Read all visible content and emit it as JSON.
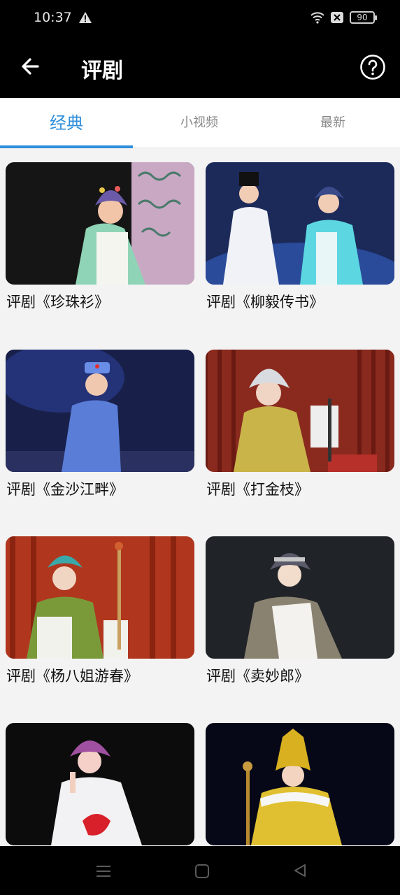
{
  "status": {
    "time": "10:37",
    "battery": "90"
  },
  "header": {
    "title": "评剧"
  },
  "tabs": [
    {
      "label": "经典",
      "active": true
    },
    {
      "label": "小视频",
      "active": false
    },
    {
      "label": "最新",
      "active": false
    }
  ],
  "videos": [
    {
      "title": "评剧《珍珠衫》"
    },
    {
      "title": "评剧《柳毅传书》"
    },
    {
      "title": "评剧《金沙江畔》"
    },
    {
      "title": "评剧《打金枝》"
    },
    {
      "title": "评剧《杨八姐游春》"
    },
    {
      "title": "评剧《卖妙郎》"
    },
    {
      "title": ""
    },
    {
      "title": ""
    }
  ],
  "colors": {
    "accent": "#2f8fdc",
    "header_bg": "#000000",
    "content_bg": "#f3f3f3"
  }
}
